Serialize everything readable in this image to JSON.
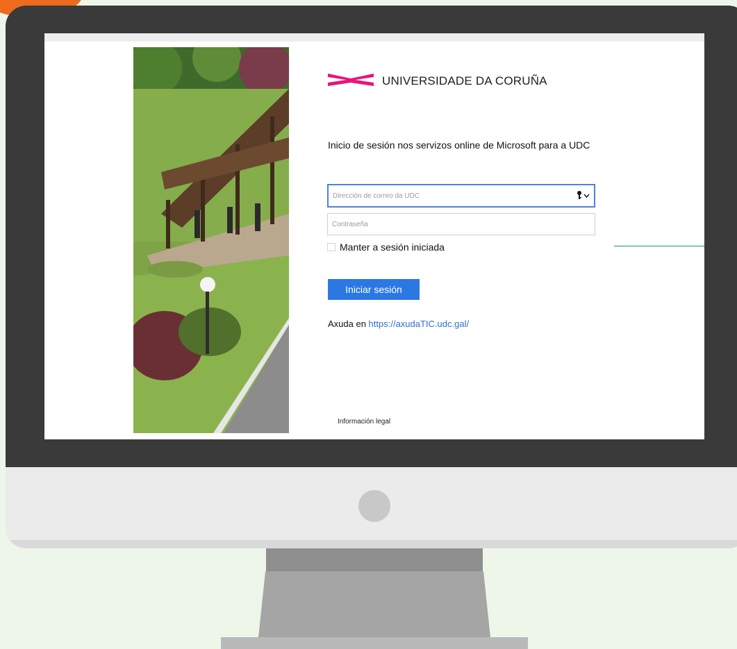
{
  "brand": {
    "name": "UNIVERSIDADE DA CORUÑA",
    "logo_color": "#e8157a"
  },
  "signin": {
    "heading": "Inicio de sesión nos servizos online de Microsoft para a UDC",
    "email_placeholder": "Dirección de correo da UDC",
    "password_placeholder": "Contraseña",
    "remember_label": "Manter a sesión iniciada",
    "remember_checked": false,
    "submit_label": "Iniciar sesión",
    "help_prefix": "Axuda en",
    "help_link": "https://axudaTIC.udc.gal/",
    "legal_label": "Información legal"
  },
  "icons": {
    "key": "key-icon",
    "dropdown": "chevron-down-icon"
  },
  "colors": {
    "accent": "#2b78e4",
    "link": "#2b6fd1",
    "focus_border": "#4f7fde",
    "callout": "#1d8a86"
  }
}
